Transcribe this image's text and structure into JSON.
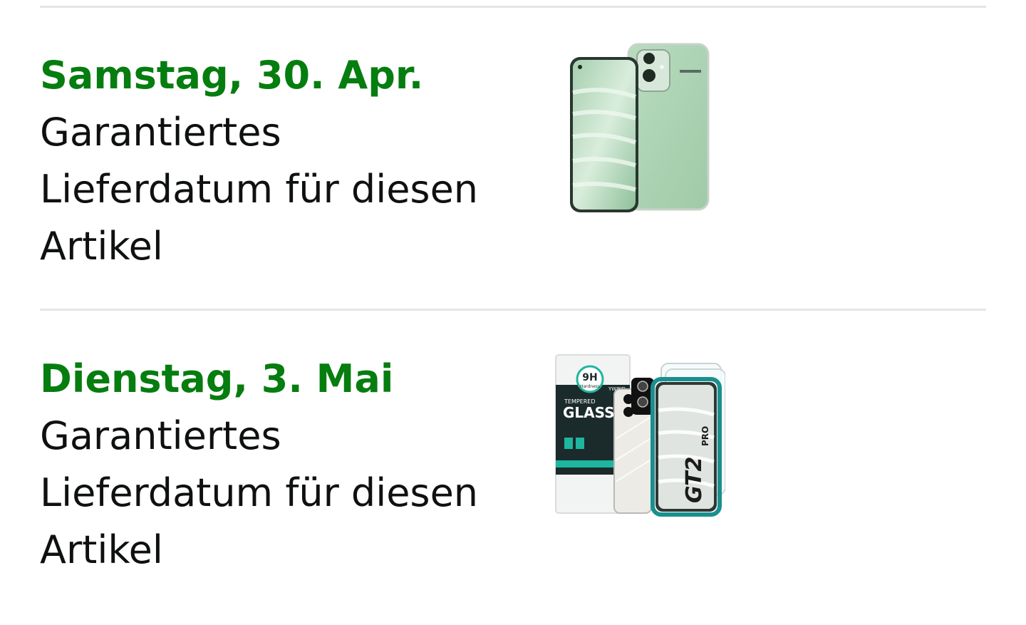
{
  "shipments": [
    {
      "date": "Samstag, 30. Apr.",
      "desc_line1": "Garantiertes",
      "desc_line2": "Lieferdatum für diesen",
      "desc_line3": "Artikel",
      "image": "phone-case-product-image"
    },
    {
      "date": "Dienstag, 3. Mai",
      "desc_line1": "Garantiertes",
      "desc_line2": "Lieferdatum für diesen",
      "desc_line3": "Artikel",
      "image": "screen-protector-product-image",
      "image_text": {
        "badge": "9H",
        "badge_sub": "Hardness",
        "box_small": "TEMPERED",
        "box_big": "GLASS",
        "brand": "YWIND",
        "model": "GT2",
        "model_suffix": "PRO"
      }
    }
  ],
  "colors": {
    "date_green": "#067d0f",
    "divider": "#e3e6e6",
    "text": "#0f1111"
  }
}
